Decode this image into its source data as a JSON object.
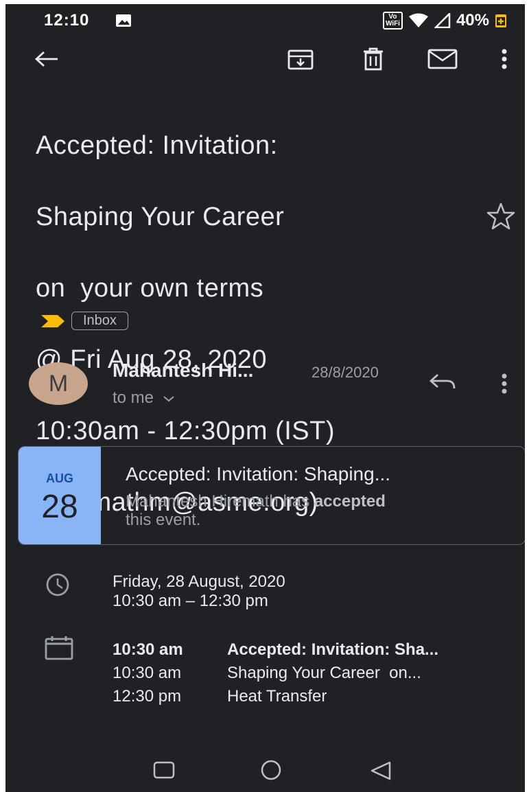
{
  "status_bar": {
    "time": "12:10",
    "vowifi": "Vo\nWiFi",
    "battery": "40%"
  },
  "toolbar": {
    "back": "back-arrow-icon",
    "archive": "archive-icon",
    "delete": "trash-icon",
    "mark_unread": "mail-icon",
    "more": "more-vert-icon"
  },
  "email": {
    "subject_lines": [
      "Accepted: Invitation:",
      "Shaping Your Career",
      "on  your own terms",
      "@ Fri Aug 28, 2020",
      "10:30am - 12:30pm (IST)",
      "(hiremathm@asme.org)"
    ],
    "label": "Inbox",
    "sender": {
      "initial": "M",
      "name": "Mahantesh Hi...",
      "date": "28/8/2020",
      "recipient": "to me"
    }
  },
  "event_card": {
    "month": "AUG",
    "day": "28",
    "title": "Accepted: Invitation: Shaping...",
    "desc_prefix": "Mahantesh Hiremath has ",
    "desc_bold": "accepted",
    "desc_suffix": "this event."
  },
  "when": {
    "date": "Friday, 28 August, 2020",
    "time": "10:30 am – 12:30 pm"
  },
  "schedule": [
    {
      "time": "10:30 am",
      "title": "Accepted: Invitation: Sha..."
    },
    {
      "time": "10:30 am",
      "title": "Shaping Your Career  on..."
    },
    {
      "time": "12:30 pm",
      "title": "Heat Transfer"
    }
  ],
  "colors": {
    "background": "#202124",
    "card_accent": "#8ab4f8",
    "avatar": "#c8a68e",
    "label_marker": "#fbbc04"
  }
}
